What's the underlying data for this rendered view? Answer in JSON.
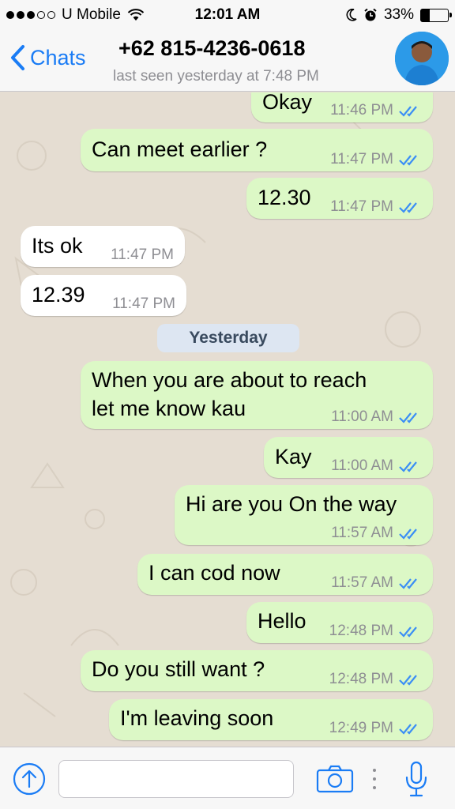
{
  "status_bar": {
    "carrier": "U Mobile",
    "time": "12:01 AM",
    "battery": "33%",
    "battery_fraction": 0.33
  },
  "nav": {
    "back_label": "Chats",
    "contact": "+62 815-4236-0618",
    "last_seen": "last seen yesterday at 7:48 PM"
  },
  "messages": [
    {
      "text": "Okay",
      "time": "11:46 PM"
    },
    {
      "text": "Can meet earlier ?",
      "time": "11:47 PM"
    },
    {
      "text": "12.30",
      "time": "11:47 PM"
    },
    {
      "text": "Its ok",
      "time": "11:47 PM"
    },
    {
      "text": "12.39",
      "time": "11:47 PM"
    },
    {
      "text": "When you are about to reach",
      "text2": "let me know kau",
      "time": "11:00 AM"
    },
    {
      "text": "Kay",
      "time": "11:00 AM"
    },
    {
      "text": "Hi are you On the way",
      "time": "11:57 AM"
    },
    {
      "text": "I can cod now",
      "time": "11:57 AM"
    },
    {
      "text": "Hello",
      "time": "12:48 PM"
    },
    {
      "text": "Do you still want ?",
      "time": "12:48 PM"
    },
    {
      "text": "I'm leaving soon",
      "time": "12:49 PM"
    }
  ],
  "date_divider": "Yesterday",
  "input": {
    "placeholder": "",
    "value": ""
  },
  "colors": {
    "outgoing_bubble": "#dcf8c6",
    "incoming_bubble": "#ffffff",
    "accent": "#1a7cf5",
    "read_ticks": "#3b8ef5",
    "background": "#e5ddd2"
  }
}
